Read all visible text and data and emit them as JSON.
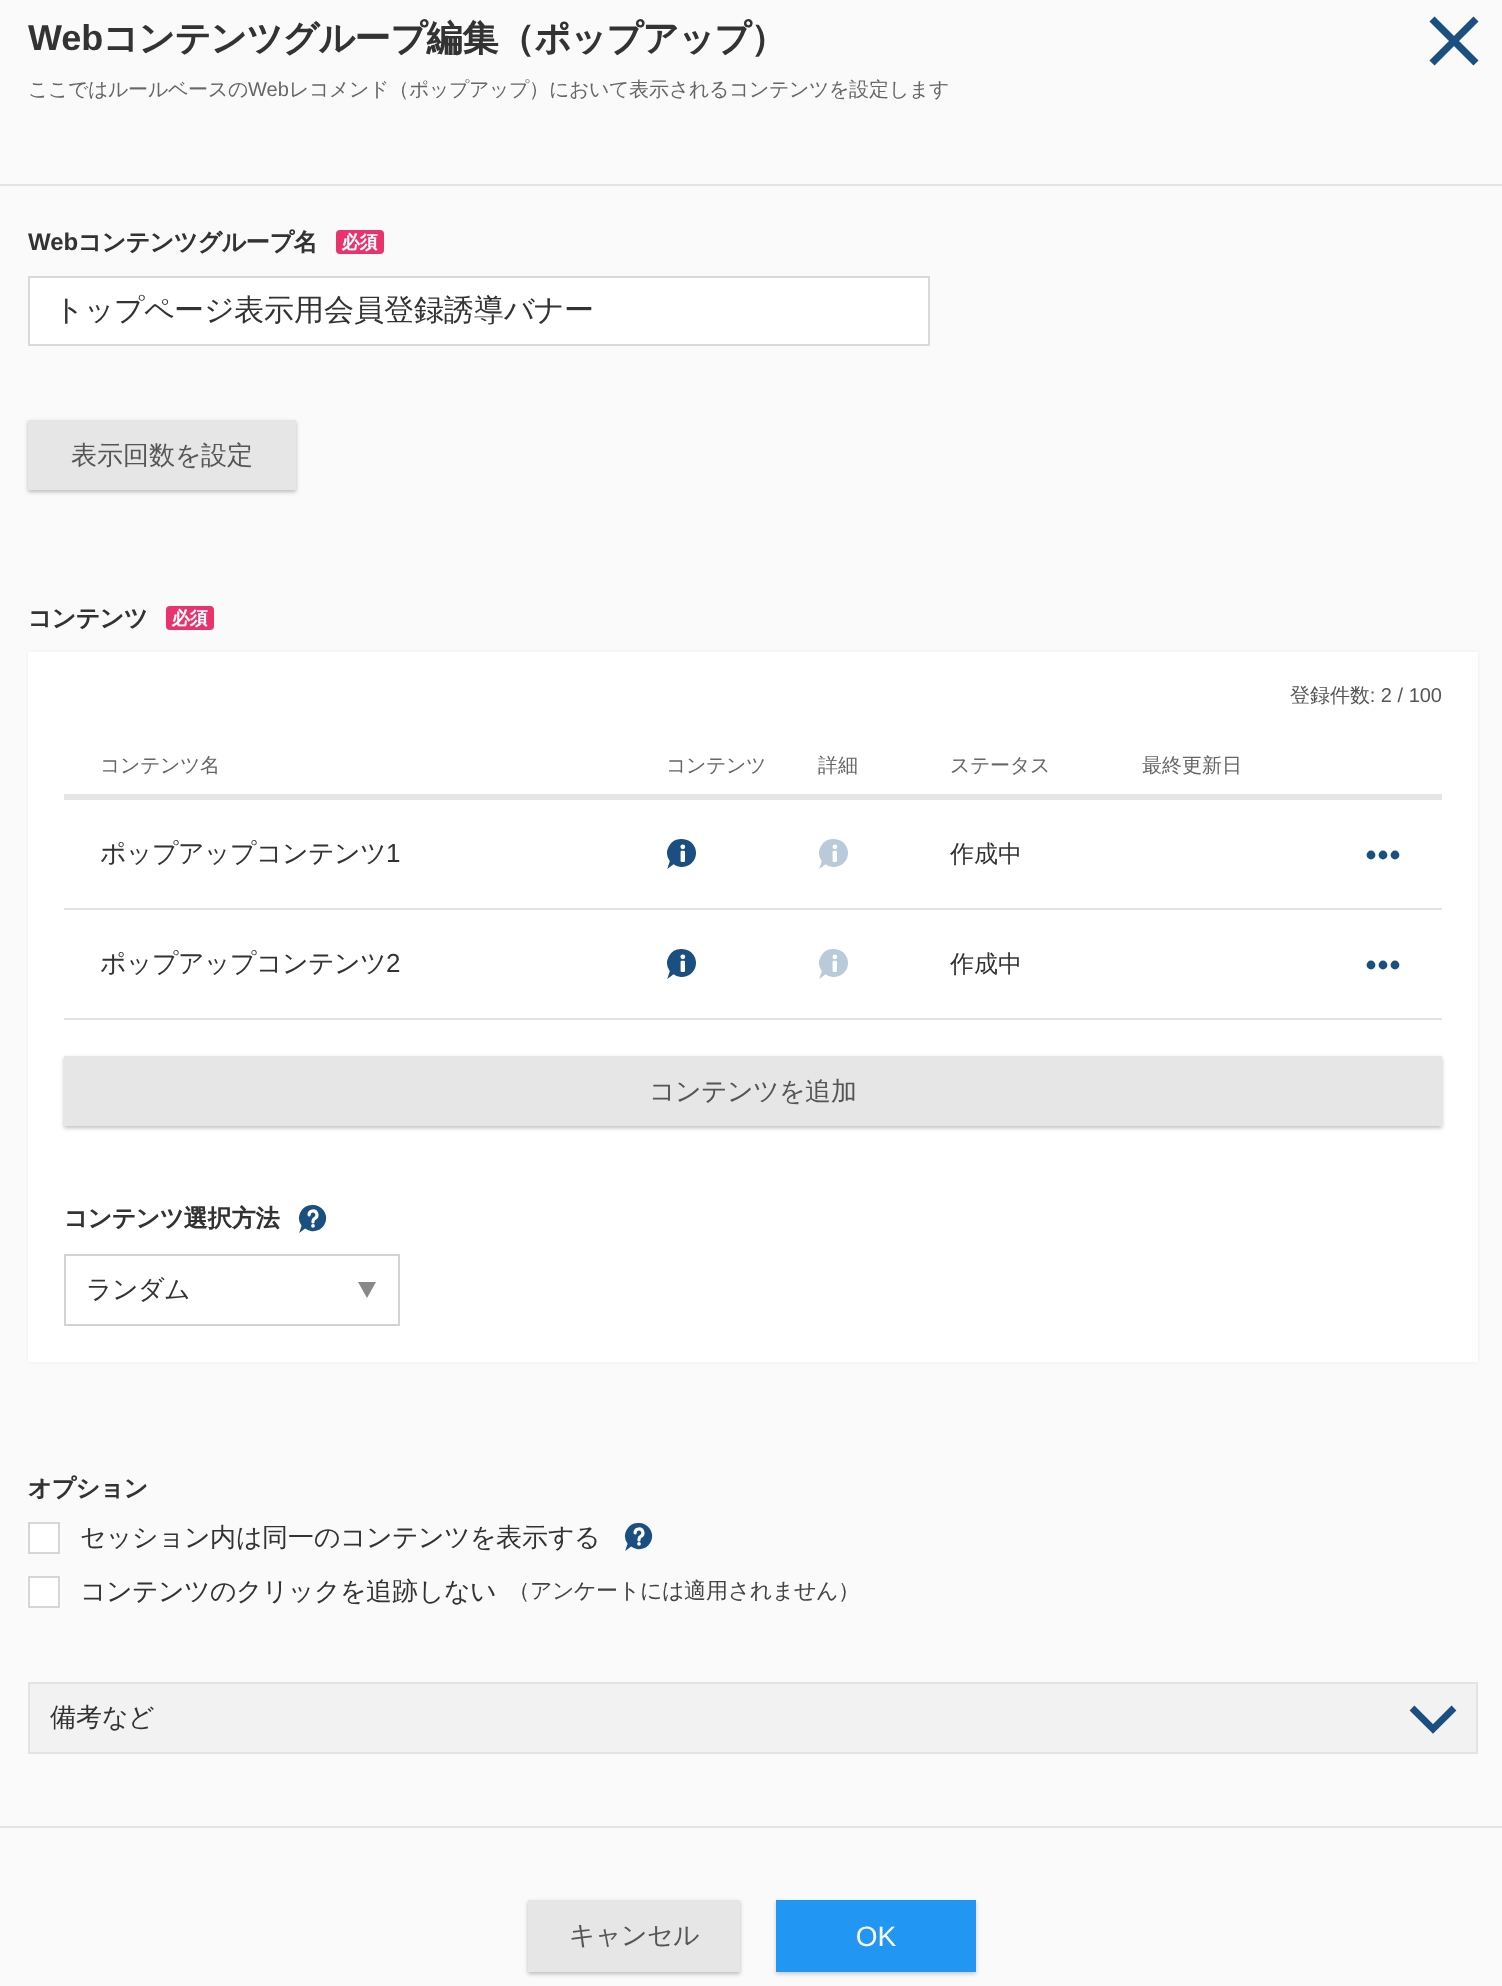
{
  "dialog": {
    "title": "Webコンテンツグループ編集（ポップアップ）",
    "description": "ここではルールベースのWebレコメンド（ポップアップ）において表示されるコンテンツを設定します"
  },
  "group_name": {
    "label": "Webコンテンツグループ名",
    "required_badge": "必須",
    "value": "トップページ表示用会員登録誘導バナー"
  },
  "display_count_button": "表示回数を設定",
  "contents": {
    "label": "コンテンツ",
    "required_badge": "必須",
    "count": "登録件数: 2 / 100",
    "columns": [
      "コンテンツ名",
      "コンテンツ",
      "詳細",
      "ステータス",
      "最終更新日"
    ],
    "rows": [
      {
        "name": "ポップアップコンテンツ1",
        "detail_disabled": true,
        "status": "作成中"
      },
      {
        "name": "ポップアップコンテンツ2",
        "detail_disabled": true,
        "status": "作成中"
      }
    ],
    "add_button": "コンテンツを追加",
    "selection_method": {
      "label": "コンテンツ選択方法",
      "value": "ランダム"
    }
  },
  "options": {
    "label": "オプション",
    "items": [
      {
        "label": "セッション内は同一のコンテンツを表示する",
        "checked": false,
        "has_help": true
      },
      {
        "label": "コンテンツのクリックを追跡しない",
        "note": "（アンケートには適用されません）",
        "checked": false,
        "has_help": false
      }
    ]
  },
  "notes_section": {
    "label": "備考など",
    "expanded": false
  },
  "buttons": [
    {
      "label": "キャンセル",
      "kind": "secondary"
    },
    {
      "label": "OK",
      "kind": "primary"
    }
  ]
}
